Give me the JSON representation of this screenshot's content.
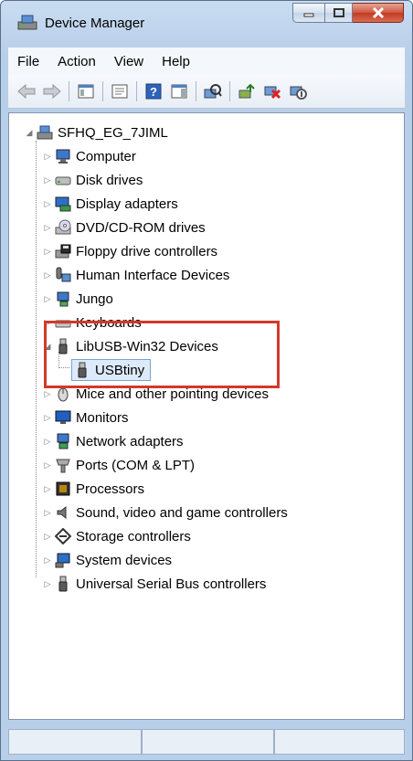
{
  "window": {
    "title": "Device Manager"
  },
  "menu": [
    "File",
    "Action",
    "View",
    "Help"
  ],
  "tree": {
    "root": "SFHQ_EG_7JIML",
    "items": [
      {
        "label": "Computer",
        "icon": "computer-icon"
      },
      {
        "label": "Disk drives",
        "icon": "disk-drive-icon"
      },
      {
        "label": "Display adapters",
        "icon": "display-adapter-icon"
      },
      {
        "label": "DVD/CD-ROM drives",
        "icon": "dvd-drive-icon"
      },
      {
        "label": "Floppy drive controllers",
        "icon": "floppy-controller-icon"
      },
      {
        "label": "Human Interface Devices",
        "icon": "hid-icon"
      },
      {
        "label": "Jungo",
        "icon": "jungo-icon"
      },
      {
        "label": "Keyboards",
        "icon": "keyboard-icon"
      },
      {
        "label": "LibUSB-Win32 Devices",
        "icon": "usb-plug-icon",
        "expanded": true,
        "children": [
          {
            "label": "USBtiny",
            "icon": "usb-plug-icon",
            "selected": true
          }
        ]
      },
      {
        "label": "Mice and other pointing devices",
        "icon": "mouse-icon"
      },
      {
        "label": "Monitors",
        "icon": "monitor-icon"
      },
      {
        "label": "Network adapters",
        "icon": "network-adapter-icon"
      },
      {
        "label": "Ports (COM & LPT)",
        "icon": "port-icon"
      },
      {
        "label": "Processors",
        "icon": "processor-icon"
      },
      {
        "label": "Sound, video and game controllers",
        "icon": "speaker-icon"
      },
      {
        "label": "Storage controllers",
        "icon": "storage-controller-icon"
      },
      {
        "label": "System devices",
        "icon": "system-devices-icon"
      },
      {
        "label": "Universal Serial Bus controllers",
        "icon": "usb-plug-icon"
      }
    ]
  },
  "colors": {
    "highlight_border": "#d23a28",
    "selection": "#dceaf9"
  }
}
